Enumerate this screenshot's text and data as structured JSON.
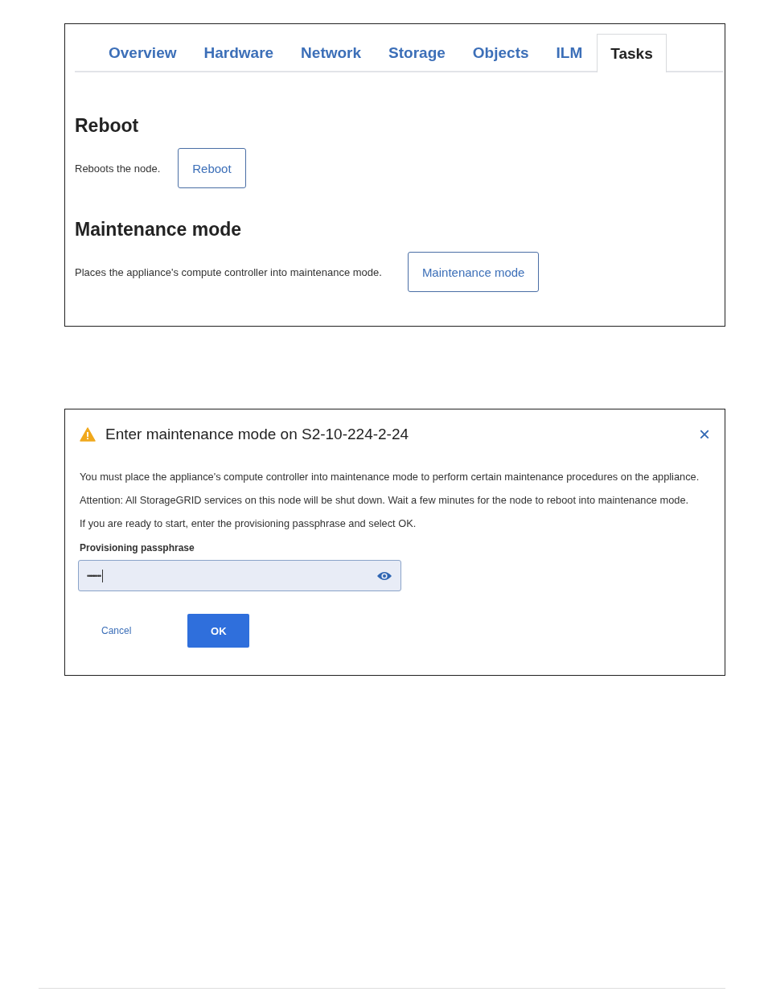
{
  "tasks_panel": {
    "tabs": [
      {
        "label": "Overview",
        "selected": false
      },
      {
        "label": "Hardware",
        "selected": false
      },
      {
        "label": "Network",
        "selected": false
      },
      {
        "label": "Storage",
        "selected": false
      },
      {
        "label": "Objects",
        "selected": false
      },
      {
        "label": "ILM",
        "selected": false
      },
      {
        "label": "Tasks",
        "selected": true
      }
    ],
    "sections": [
      {
        "heading": "Reboot",
        "description": "Reboots the node.",
        "button": "Reboot"
      },
      {
        "heading": "Maintenance mode",
        "description": "Places the appliance's compute controller into maintenance mode.",
        "button": "Maintenance mode"
      }
    ]
  },
  "dialog": {
    "title": "Enter maintenance mode on S2-10-224-2-24",
    "close": "×",
    "paragraphs": [
      "You must place the appliance's compute controller into maintenance mode to perform certain maintenance procedures on the appliance.",
      "Attention: All StorageGRID services on this node will be shut down. Wait a few minutes for the node to reboot into maintenance mode.",
      "If you are ready to start, enter the provisioning passphrase and select OK."
    ],
    "field": {
      "label": "Provisioning passphrase",
      "value": "••••••••"
    },
    "buttons": [
      {
        "label": "Cancel",
        "kind": "link"
      },
      {
        "label": "OK",
        "kind": "primary"
      }
    ]
  }
}
